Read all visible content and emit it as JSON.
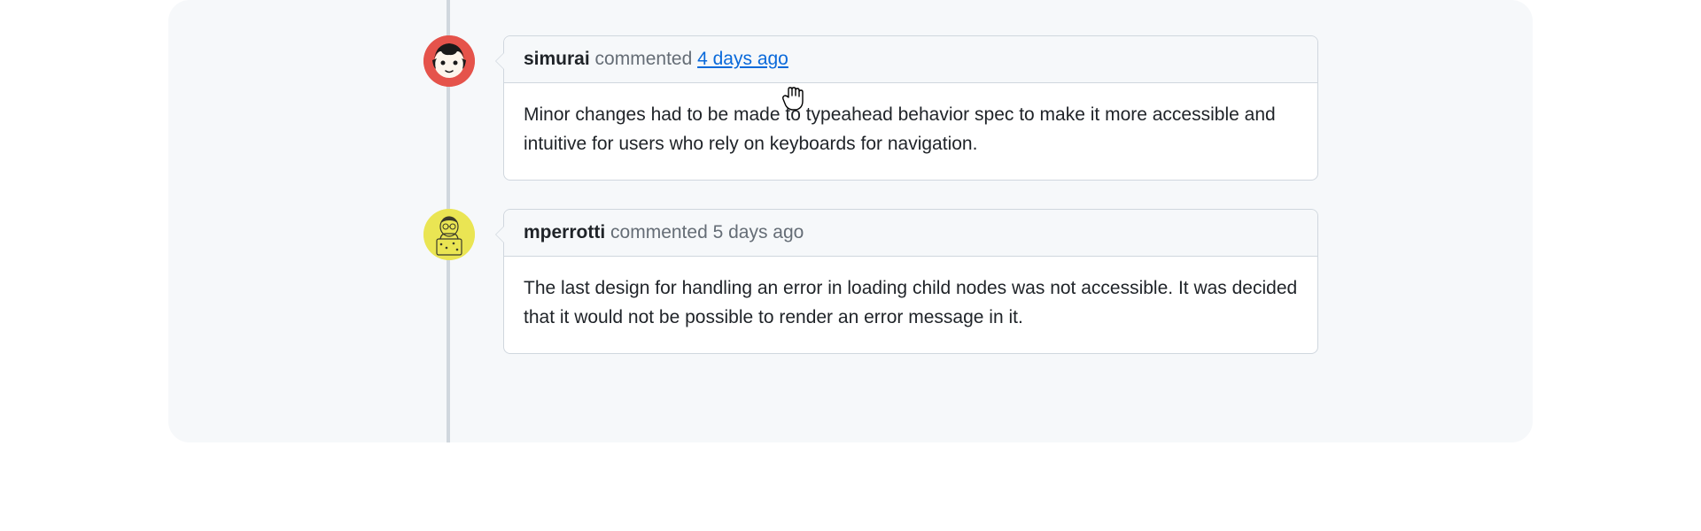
{
  "comments": [
    {
      "author": "simurai",
      "action": "commented",
      "timestamp": "4 days ago",
      "timestamp_is_link": true,
      "avatar_bg": "#e5534b",
      "body": "Minor changes had to be made to typeahead behavior spec to make it more accessible and intuitive for users who rely on keyboards for navigation."
    },
    {
      "author": "mperrotti",
      "action": "commented",
      "timestamp": "5 days ago",
      "timestamp_is_link": false,
      "avatar_bg": "#eae553",
      "body": "The last design for handling an error in loading child nodes was not accessible. It was decided that it would not be possible to render an error message in it."
    }
  ],
  "colors": {
    "link": "#0969da",
    "muted": "#656d76",
    "border": "#d0d7de",
    "bg_subtle": "#f6f8fa"
  }
}
